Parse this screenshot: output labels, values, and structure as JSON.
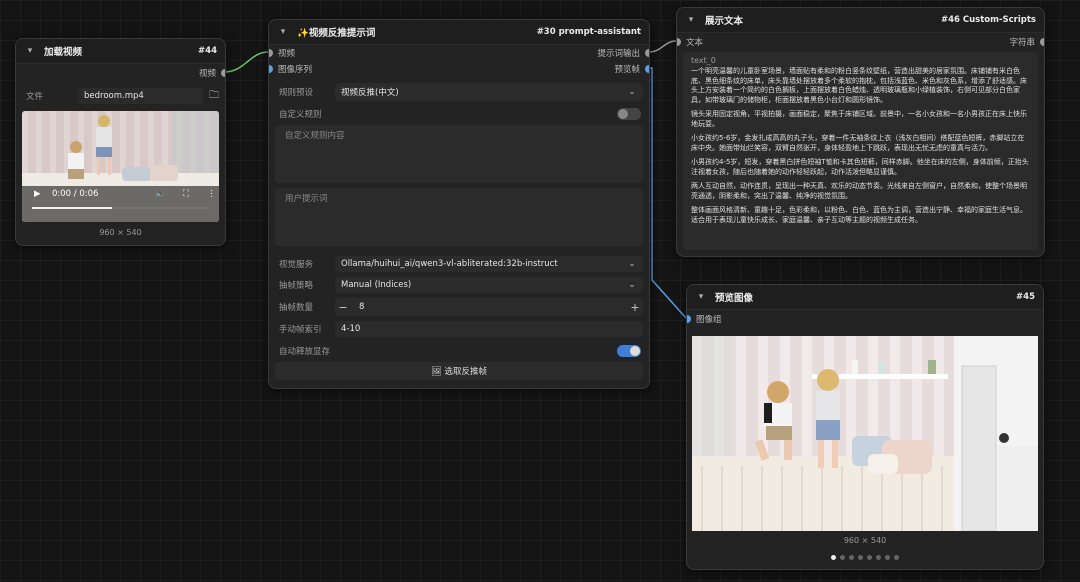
{
  "nodes": {
    "load_video": {
      "title": "加载视频",
      "id": "#44",
      "output_label": "视频",
      "file_label": "文件",
      "file_value": "bedroom.mp4",
      "time": "0:00 / 0:06",
      "progress": 0.45,
      "size": "960 × 540"
    },
    "prompt": {
      "title": "✨视频反推提示词",
      "id": "#30 prompt-assistant",
      "inputs": [
        "视频",
        "图像序列"
      ],
      "outputs": [
        "提示词输出",
        "预览帧"
      ],
      "preset_label": "规则预设",
      "preset_value": "视频反推(中文)",
      "custom_rule_label": "自定义规则",
      "custom_rule_placeholder": "自定义规则内容",
      "user_prompt_placeholder": "用户提示词",
      "service_label": "视觉服务",
      "service_value": "Ollama/huihui_ai/qwen3-vl-abliterated:32b-instruct",
      "strategy_label": "抽帧策略",
      "strategy_value": "Manual (Indices)",
      "count_label": "抽帧数量",
      "count_minus": "−",
      "count_value": "8",
      "count_plus": "+",
      "manual_index_label": "手动帧索引",
      "manual_index_value": "4-10",
      "auto_release_label": "自动释放显存",
      "auto_release_on": true,
      "select_button": "🖼 选取反推帧"
    },
    "show_text": {
      "title": "展示文本",
      "id": "#46 Custom-Scripts",
      "input_label": "文本",
      "output_label": "字符串",
      "text_name": "text_0",
      "paragraphs": [
        "一个明亮温馨的儿童卧室场景，墙面贴有柔和的粉白竖条纹壁纸，营造出甜美的居家氛围。床铺铺有米白色底、黑色细条纹的床单，床头靠墙处摆放着多个柔软的抱枕，包括浅蓝色、米色和灰色系，增添了舒适感。床头上方安装着一个简约的白色搁板，上面摆放着白色蜡烛、透明玻璃瓶和小绿植装饰，右侧可见部分白色家具，如带玻璃门的储物柜，柜面摆放着黑色小台灯和圆形镜饰。",
        "镜头采用固定视角，平视拍摄，画面稳定，聚焦于床铺区域。前景中，一名小女孩和一名小男孩正在床上快乐地玩耍。",
        "小女孩约5-6岁，金发扎成高高的丸子头，穿着一件无袖条纹上衣（浅灰白相间）搭配蓝色短裤，赤脚站立在床中央。她面带灿烂笑容，双臂自然张开，身体轻盈地上下跳跃，表现出无忧无虑的童真与活力。",
        "小男孩约4-5岁，短发，穿着黑白拼色短袖T恤和卡其色短裤，同样赤脚。他坐在床的左侧，身体前倾，正抬头注视着女孩，随后也随着她的动作轻轻跃起，动作活泼但略显谨慎。",
        "两人互动自然，动作连贯，呈现出一种天真、欢乐的动态节奏。光线来自左侧窗户，自然柔和，使整个场景明亮通透，阴影柔和，突出了温馨、纯净的视觉氛围。",
        "整体画面风格清新、童趣十足，色彩柔和，以粉色、白色、蓝色为主调，营造出宁静、幸福的家庭生活气息。适合用于表现儿童快乐成长、家庭温馨、亲子互动等主题的视频生成任务。"
      ]
    },
    "preview": {
      "title": "预览图像",
      "id": "#45",
      "input_label": "图像组",
      "size": "960 × 540",
      "pages": 8,
      "current_page": 0
    }
  },
  "colors": {
    "wire_green": "#6cc36c",
    "wire_blue": "#5aa0e8",
    "toggle_on": "#3f7fd8"
  }
}
